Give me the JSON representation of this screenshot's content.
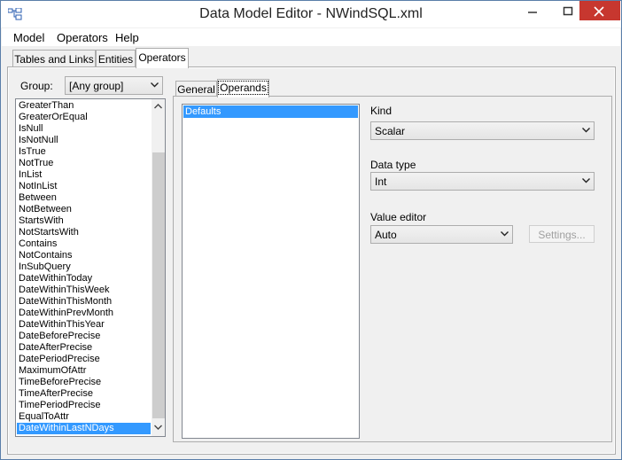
{
  "window": {
    "title": "Data Model Editor - NWindSQL.xml"
  },
  "menu": {
    "items": [
      "Model",
      "Operators",
      "Help"
    ]
  },
  "tabs": {
    "items": [
      "Tables and Links",
      "Entities",
      "Operators"
    ],
    "active": "Operators"
  },
  "group": {
    "label": "Group:",
    "value": "[Any group]"
  },
  "operators": {
    "items": [
      "GreaterThan",
      "GreaterOrEqual",
      "IsNull",
      "IsNotNull",
      "IsTrue",
      "NotTrue",
      "InList",
      "NotInList",
      "Between",
      "NotBetween",
      "StartsWith",
      "NotStartsWith",
      "Contains",
      "NotContains",
      "InSubQuery",
      "DateWithinToday",
      "DateWithinThisWeek",
      "DateWithinThisMonth",
      "DateWithinPrevMonth",
      "DateWithinThisYear",
      "DateBeforePrecise",
      "DateAfterPrecise",
      "DatePeriodPrecise",
      "MaximumOfAttr",
      "TimeBeforePrecise",
      "TimeAfterPrecise",
      "TimePeriodPrecise",
      "EqualToAttr",
      "DateWithinLastNDays"
    ],
    "selected": "DateWithinLastNDays"
  },
  "inner_tabs": {
    "items": [
      "General",
      "Operands"
    ],
    "active": "Operands"
  },
  "operands": {
    "items": [
      "Defaults"
    ]
  },
  "kind": {
    "label": "Kind",
    "value": "Scalar"
  },
  "data_type": {
    "label": "Data type",
    "value": "Int"
  },
  "value_editor": {
    "label": "Value editor",
    "value": "Auto",
    "settings_label": "Settings..."
  },
  "colors": {
    "selection": "#3399ff",
    "close_button": "#c7372f"
  }
}
